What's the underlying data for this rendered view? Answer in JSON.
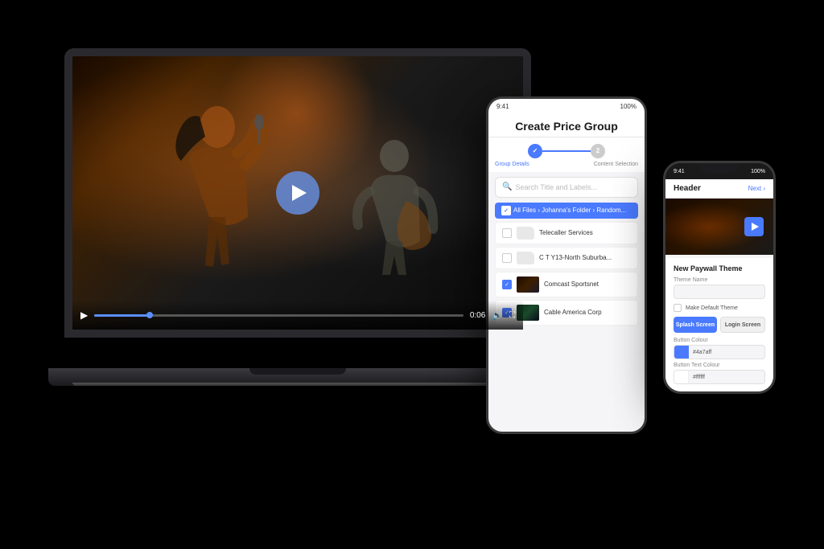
{
  "background": "#000000",
  "laptop": {
    "video": {
      "play_button_visible": true
    },
    "controls": {
      "time": "0:06",
      "progress_percent": 15
    }
  },
  "tablet": {
    "status_bar": {
      "left": "9:41",
      "right": "100%"
    },
    "title": "Create Price Group",
    "steps": [
      {
        "number": "1",
        "label": "Group Details",
        "active": true
      },
      {
        "number": "2",
        "label": "Content Selection",
        "active": false
      }
    ],
    "search_placeholder": "Search Title and Labels...",
    "breadcrumb": "All Files › Johanna's Folder › Random...",
    "files": [
      {
        "name": "Telecaller Services",
        "type": "folder",
        "checked": false
      },
      {
        "name": "C T Y13-North Suburba...",
        "type": "folder",
        "checked": false
      },
      {
        "name": "Comcast Sportsnet",
        "type": "video",
        "checked": true
      },
      {
        "name": "Cable America Corp",
        "type": "video",
        "checked": true
      }
    ]
  },
  "phone": {
    "status": {
      "time": "9:41",
      "battery": "100%"
    },
    "header": {
      "title": "Header",
      "action": "Next ›"
    },
    "paywall_section_title": "New Paywall Theme",
    "theme_name_label": "Theme Name",
    "theme_name_value": "",
    "make_default_label": "Make Default Theme",
    "splash_btn": "Splash Screen",
    "login_btn": "Login Screen",
    "button_colour_label": "Button Colour",
    "button_colour_value": "#4a7aff",
    "button_text_colour_label": "Button Text Colour",
    "button_text_colour_value": "#ffffff"
  }
}
